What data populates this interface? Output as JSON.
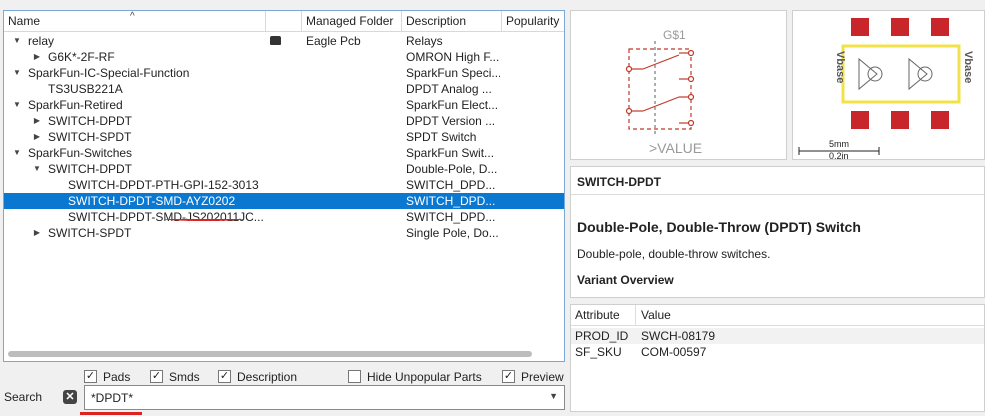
{
  "columns": {
    "name": "Name",
    "managed": "Managed Folder",
    "description": "Description",
    "popularity": "Popularity"
  },
  "rows": [
    {
      "level": 0,
      "arrow": "▼",
      "name": "relay",
      "managed": "Eagle Pcb",
      "description": "Relays",
      "folder_icon": true
    },
    {
      "level": 1,
      "arrow": "▶",
      "name": "G6K*-2F-RF",
      "managed": "",
      "description": "OMRON High F..."
    },
    {
      "level": 0,
      "arrow": "▼",
      "name": "SparkFun-IC-Special-Function",
      "managed": "",
      "description": "SparkFun Speci..."
    },
    {
      "level": 1,
      "arrow": "",
      "name": "TS3USB221A",
      "managed": "",
      "description": "DPDT Analog ..."
    },
    {
      "level": 0,
      "arrow": "▼",
      "name": "SparkFun-Retired",
      "managed": "",
      "description": "SparkFun Elect..."
    },
    {
      "level": 1,
      "arrow": "▶",
      "name": "SWITCH-DPDT",
      "managed": "",
      "description": "DPDT Version ..."
    },
    {
      "level": 1,
      "arrow": "▶",
      "name": "SWITCH-SPDT",
      "managed": "",
      "description": "SPDT Switch"
    },
    {
      "level": 0,
      "arrow": "▼",
      "name": "SparkFun-Switches",
      "managed": "",
      "description": "SparkFun Swit..."
    },
    {
      "level": 1,
      "arrow": "▼",
      "name": "SWITCH-DPDT",
      "managed": "",
      "description": "Double-Pole, D..."
    },
    {
      "level": 2,
      "arrow": "",
      "name": "SWITCH-DPDT-PTH-GPI-152-3013",
      "managed": "",
      "description": "SWITCH_DPD..."
    },
    {
      "level": 2,
      "arrow": "",
      "name": "SWITCH-DPDT-SMD-AYZ0202",
      "managed": "",
      "description": "SWITCH_DPD...",
      "selected": true
    },
    {
      "level": 2,
      "arrow": "",
      "name": "SWITCH-DPDT-SMD-JS202011JC...",
      "managed": "",
      "description": "SWITCH_DPD..."
    },
    {
      "level": 1,
      "arrow": "▶",
      "name": "SWITCH-SPDT",
      "managed": "",
      "description": "Single Pole, Do..."
    }
  ],
  "filters": {
    "pads": {
      "label": "Pads",
      "checked": true
    },
    "smds": {
      "label": "Smds",
      "checked": true
    },
    "description": {
      "label": "Description",
      "checked": true
    },
    "hide_unpopular": {
      "label": "Hide Unpopular Parts",
      "checked": false
    },
    "preview": {
      "label": "Preview",
      "checked": true
    }
  },
  "search": {
    "label": "Search",
    "value": "*DPDT*"
  },
  "symbol_preview": {
    "name_label": "G$1",
    "value_label": ">VALUE"
  },
  "package_preview": {
    "left_text": "Vbase",
    "right_text": "Vbase",
    "scale_top": "5mm",
    "scale_bottom": "0.2in"
  },
  "description_panel": {
    "title": "SWITCH-DPDT",
    "heading": "Double-Pole, Double-Throw (DPDT) Switch",
    "text": "Double-pole, double-throw switches.",
    "subheading": "Variant Overview"
  },
  "attributes": {
    "header_attr": "Attribute",
    "header_value": "Value",
    "items": [
      {
        "attr": "PROD_ID",
        "value": "SWCH-08179"
      },
      {
        "attr": "SF_SKU",
        "value": "COM-00597"
      }
    ]
  },
  "colors": {
    "selection": "#0a78d0",
    "symbol_red": "#c0392b",
    "pad_red": "#c8262b",
    "outline_yellow": "#f2e24a",
    "accent_underline": "#dd2222"
  }
}
